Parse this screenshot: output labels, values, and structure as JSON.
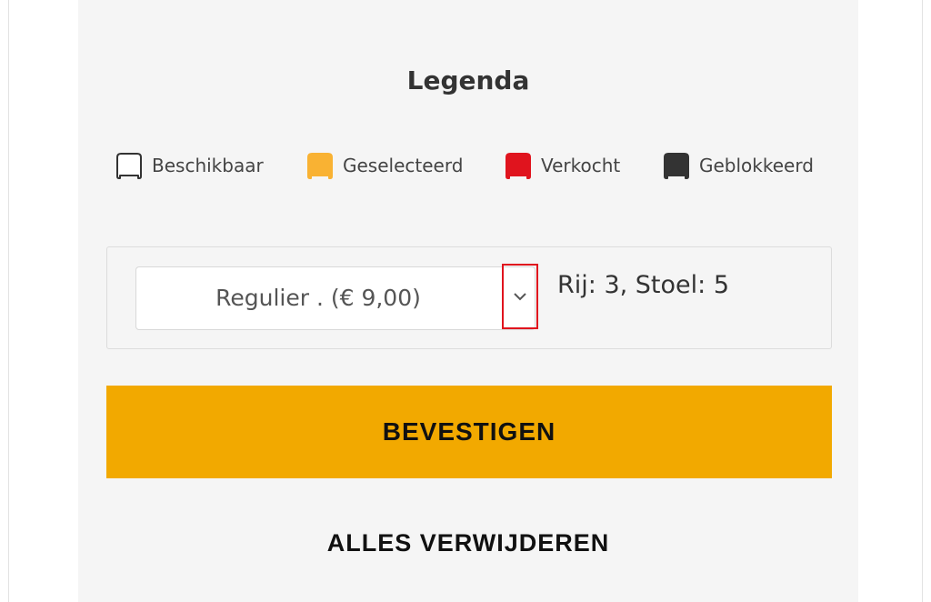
{
  "legend": {
    "title": "Legenda",
    "items": [
      {
        "label": "Beschikbaar",
        "icon": "seat-outline-icon",
        "color": "#ffffff",
        "stroke": "#333333"
      },
      {
        "label": "Geselecteerd",
        "icon": "seat-selected-icon",
        "color": "#f9b233",
        "stroke": "#f9b233"
      },
      {
        "label": "Verkocht",
        "icon": "seat-sold-icon",
        "color": "#e0141e",
        "stroke": "#e0141e"
      },
      {
        "label": "Geblokkeerd",
        "icon": "seat-blocked-icon",
        "color": "#333333",
        "stroke": "#333333"
      }
    ]
  },
  "ticket": {
    "selected_option": "Regulier . (€ 9,00)",
    "seat_info": "Rij: 3, Stoel: 5",
    "highlight_color": "#e0141e"
  },
  "actions": {
    "confirm_label": "BEVESTIGEN",
    "confirm_color": "#f2a900",
    "remove_all_label": "ALLES VERWIJDEREN"
  }
}
